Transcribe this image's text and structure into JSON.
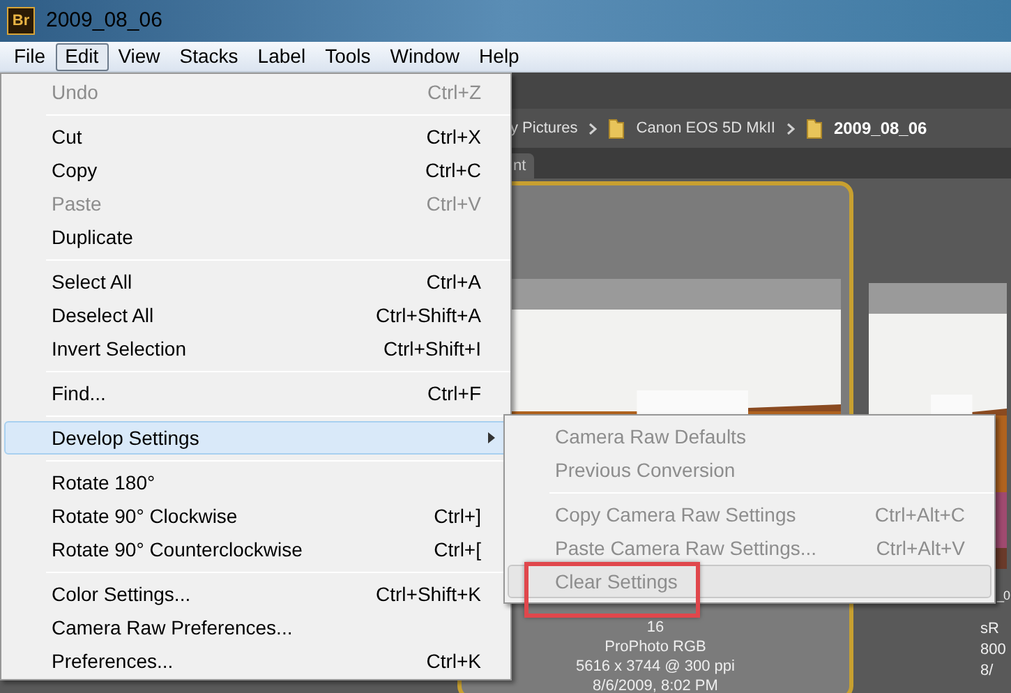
{
  "window": {
    "app_badge": "Br",
    "title": "2009_08_06"
  },
  "menubar": [
    {
      "label": "File",
      "selected": false
    },
    {
      "label": "Edit",
      "selected": true
    },
    {
      "label": "View",
      "selected": false
    },
    {
      "label": "Stacks",
      "selected": false
    },
    {
      "label": "Label",
      "selected": false
    },
    {
      "label": "Tools",
      "selected": false
    },
    {
      "label": "Window",
      "selected": false
    },
    {
      "label": "Help",
      "selected": false
    }
  ],
  "path_bar": [
    {
      "label": "y Pictures",
      "current": false
    },
    {
      "label": "Canon EOS 5D MkII",
      "current": false
    },
    {
      "label": "2009_08_06",
      "current": true
    }
  ],
  "tab": {
    "label": "nt"
  },
  "thumbnails": [
    {
      "selected": true,
      "lines": [
        "16",
        "ProPhoto RGB",
        "5616 x 3744 @ 300 ppi",
        "8/6/2009, 8:02 PM"
      ]
    },
    {
      "selected": false,
      "lines": [
        "_0",
        "sR",
        "800",
        "8/"
      ]
    }
  ],
  "edit_menu": [
    {
      "kind": "item",
      "label": "Undo",
      "shortcut": "Ctrl+Z",
      "disabled": true,
      "highlighted": false,
      "has_submenu": false
    },
    {
      "kind": "separator"
    },
    {
      "kind": "item",
      "label": "Cut",
      "shortcut": "Ctrl+X",
      "disabled": false,
      "highlighted": false,
      "has_submenu": false
    },
    {
      "kind": "item",
      "label": "Copy",
      "shortcut": "Ctrl+C",
      "disabled": false,
      "highlighted": false,
      "has_submenu": false
    },
    {
      "kind": "item",
      "label": "Paste",
      "shortcut": "Ctrl+V",
      "disabled": true,
      "highlighted": false,
      "has_submenu": false
    },
    {
      "kind": "item",
      "label": "Duplicate",
      "disabled": false,
      "highlighted": false,
      "has_submenu": false
    },
    {
      "kind": "separator"
    },
    {
      "kind": "item",
      "label": "Select All",
      "shortcut": "Ctrl+A",
      "disabled": false,
      "highlighted": false,
      "has_submenu": false
    },
    {
      "kind": "item",
      "label": "Deselect All",
      "shortcut": "Ctrl+Shift+A",
      "disabled": false,
      "highlighted": false,
      "has_submenu": false
    },
    {
      "kind": "item",
      "label": "Invert Selection",
      "shortcut": "Ctrl+Shift+I",
      "disabled": false,
      "highlighted": false,
      "has_submenu": false
    },
    {
      "kind": "separator"
    },
    {
      "kind": "item",
      "label": "Find...",
      "shortcut": "Ctrl+F",
      "disabled": false,
      "highlighted": false,
      "has_submenu": false
    },
    {
      "kind": "separator"
    },
    {
      "kind": "item",
      "label": "Develop Settings",
      "disabled": false,
      "highlighted": true,
      "has_submenu": true
    },
    {
      "kind": "separator"
    },
    {
      "kind": "item",
      "label": "Rotate 180°",
      "disabled": false,
      "highlighted": false,
      "has_submenu": false
    },
    {
      "kind": "item",
      "label": "Rotate 90° Clockwise",
      "shortcut": "Ctrl+]",
      "disabled": false,
      "highlighted": false,
      "has_submenu": false
    },
    {
      "kind": "item",
      "label": "Rotate 90° Counterclockwise",
      "shortcut": "Ctrl+[",
      "disabled": false,
      "highlighted": false,
      "has_submenu": false
    },
    {
      "kind": "separator"
    },
    {
      "kind": "item",
      "label": "Color Settings...",
      "shortcut": "Ctrl+Shift+K",
      "disabled": false,
      "highlighted": false,
      "has_submenu": false
    },
    {
      "kind": "item",
      "label": "Camera Raw Preferences...",
      "disabled": false,
      "highlighted": false,
      "has_submenu": false
    },
    {
      "kind": "item",
      "label": "Preferences...",
      "shortcut": "Ctrl+K",
      "disabled": false,
      "highlighted": false,
      "has_submenu": false
    }
  ],
  "develop_submenu": [
    {
      "kind": "item",
      "label": "Camera Raw Defaults",
      "disabled": true,
      "highlighted": false
    },
    {
      "kind": "item",
      "label": "Previous Conversion",
      "disabled": true,
      "highlighted": false
    },
    {
      "kind": "separator"
    },
    {
      "kind": "item",
      "label": "Copy Camera Raw Settings",
      "shortcut": "Ctrl+Alt+C",
      "disabled": true,
      "highlighted": false
    },
    {
      "kind": "item",
      "label": "Paste Camera Raw Settings...",
      "shortcut": "Ctrl+Alt+V",
      "disabled": true,
      "highlighted": false
    },
    {
      "kind": "item",
      "label": "Clear Settings",
      "disabled": true,
      "highlighted": true,
      "annotated": true
    }
  ]
}
